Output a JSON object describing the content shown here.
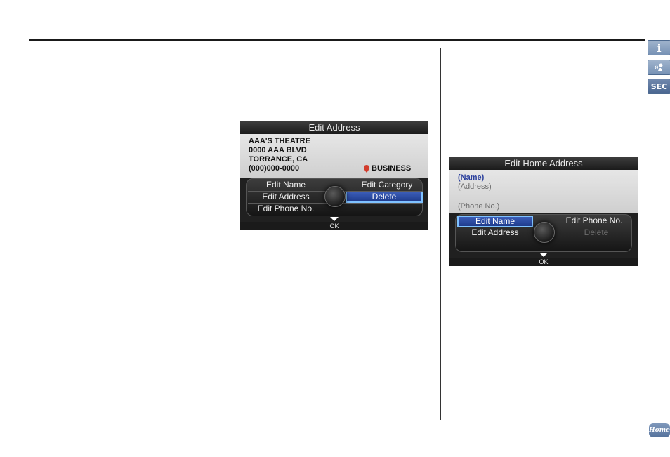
{
  "side_tabs": {
    "info_icon": "i",
    "voice_icon": "voice-icon",
    "sec_label": "SEC",
    "home_label": "Home"
  },
  "screen1": {
    "title": "Edit Address",
    "lines": [
      "AAA'S THEATRE",
      "0000 AAA BLVD",
      "TORRANCE, CA",
      "(000)000-0000"
    ],
    "category": "BUSINESS",
    "menu": {
      "edit_name": "Edit Name",
      "edit_address": "Edit Address",
      "edit_phone": "Edit Phone No.",
      "edit_category": "Edit Category",
      "delete": "Delete"
    },
    "ok": "OK"
  },
  "screen2": {
    "title_prefix": "Edit",
    "title_suffix": "Home Address",
    "name": "(Name)",
    "address": "(Address)",
    "phone": "(Phone No.)",
    "menu": {
      "edit_name": "Edit Name",
      "edit_address": "Edit Address",
      "edit_phone": "Edit Phone No.",
      "delete": "Delete"
    },
    "ok": "OK"
  },
  "colors": {
    "accent_blue": "#1e3b8c",
    "highlight_border": "#7fc2ff",
    "category_pin": "#d23c2c"
  }
}
